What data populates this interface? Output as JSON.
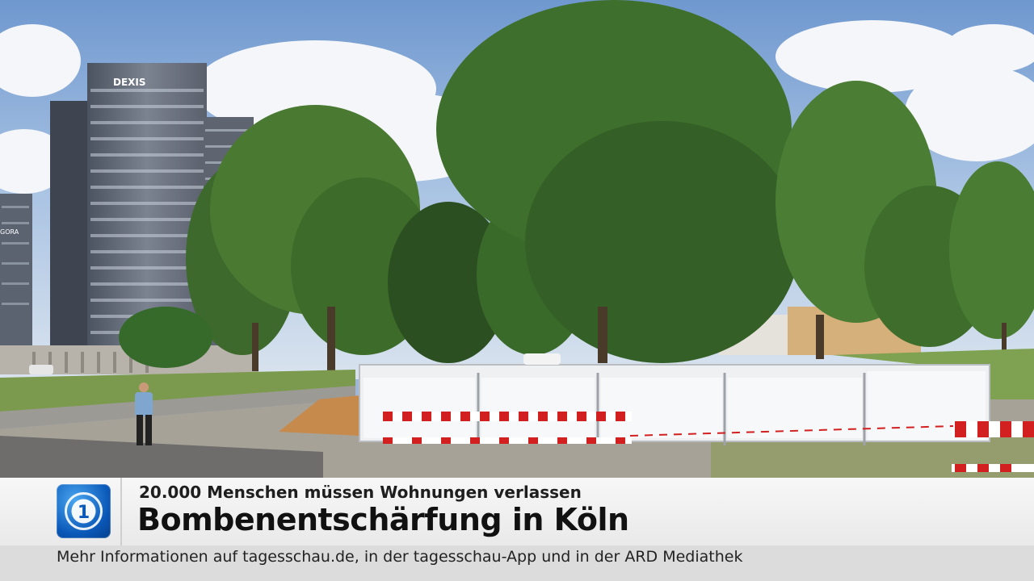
{
  "broadcast": {
    "building_sign": "DEXIS",
    "building_sign_left": "GORA",
    "logo_icon": "tagesschau-1-logo",
    "logo_text": "1"
  },
  "lower_third": {
    "subtitle": "20.000 Menschen müssen Wohnungen verlassen",
    "headline": "Bombenentschärfung in Köln"
  },
  "ticker": {
    "text": "Mehr Informationen auf tagesschau.de, in der tagesschau-App und in der ARD Mediathek"
  },
  "colors": {
    "logo_blue": "#0a58b8",
    "barrier_red": "#d22020"
  }
}
